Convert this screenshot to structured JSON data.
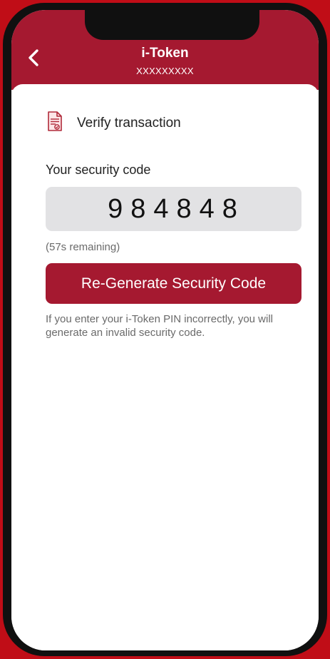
{
  "header": {
    "title": "i-Token",
    "subtitle": "XXXXXXXXX",
    "back_icon": "chevron-left-icon"
  },
  "verify": {
    "icon": "document-icon",
    "label": "Verify transaction"
  },
  "security_code": {
    "label": "Your security code",
    "value": "984848",
    "remaining": "(57s remaining)"
  },
  "regenerate_button": {
    "label": "Re-Generate Security Code"
  },
  "note": "If you enter your i-Token PIN incorrectly, you will generate an invalid security code.",
  "colors": {
    "brand": "#a51930",
    "background": "#c00d17",
    "code_box": "#e2e2e4"
  }
}
